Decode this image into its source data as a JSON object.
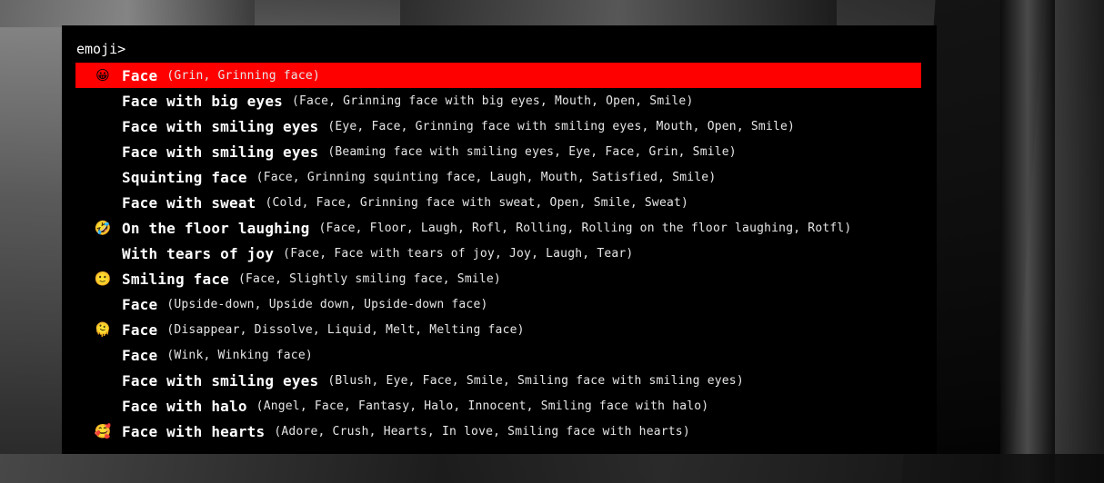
{
  "launcher": {
    "prompt": "emoji>",
    "query": "",
    "selected_index": 0,
    "accent_color": "#ff0000"
  },
  "results": [
    {
      "emoji": "😀",
      "name": "Face",
      "tags": "(Grin, Grinning face)"
    },
    {
      "emoji": "😃",
      "name": "Face with big eyes",
      "tags": "(Face, Grinning face with big eyes, Mouth, Open, Smile)"
    },
    {
      "emoji": "😄",
      "name": "Face with smiling eyes",
      "tags": "(Eye, Face, Grinning face with smiling eyes, Mouth, Open, Smile)"
    },
    {
      "emoji": "😁",
      "name": "Face with smiling eyes",
      "tags": "(Beaming face with smiling eyes, Eye, Face, Grin, Smile)"
    },
    {
      "emoji": "😆",
      "name": "Squinting face",
      "tags": "(Face, Grinning squinting face, Laugh, Mouth, Satisfied, Smile)"
    },
    {
      "emoji": "😅",
      "name": "Face with sweat",
      "tags": "(Cold, Face, Grinning face with sweat, Open, Smile, Sweat)"
    },
    {
      "emoji": "🤣",
      "name": "On the floor laughing",
      "tags": "(Face, Floor, Laugh, Rofl, Rolling, Rolling on the floor laughing, Rotfl)"
    },
    {
      "emoji": "😂",
      "name": "With tears of joy",
      "tags": "(Face, Face with tears of joy, Joy, Laugh, Tear)"
    },
    {
      "emoji": "🙂",
      "name": "Smiling face",
      "tags": "(Face, Slightly smiling face, Smile)"
    },
    {
      "emoji": "🙃",
      "name": "Face",
      "tags": "(Upside-down, Upside down, Upside-down face)"
    },
    {
      "emoji": "🫠",
      "name": "Face",
      "tags": "(Disappear, Dissolve, Liquid, Melt, Melting face)"
    },
    {
      "emoji": "😉",
      "name": "Face",
      "tags": "(Wink, Winking face)"
    },
    {
      "emoji": "😊",
      "name": "Face with smiling eyes",
      "tags": "(Blush, Eye, Face, Smile, Smiling face with smiling eyes)"
    },
    {
      "emoji": "😇",
      "name": "Face with halo",
      "tags": "(Angel, Face, Fantasy, Halo, Innocent, Smiling face with halo)"
    },
    {
      "emoji": "🥰",
      "name": "Face with hearts",
      "tags": "(Adore, Crush, Hearts, In love, Smiling face with hearts)"
    }
  ]
}
